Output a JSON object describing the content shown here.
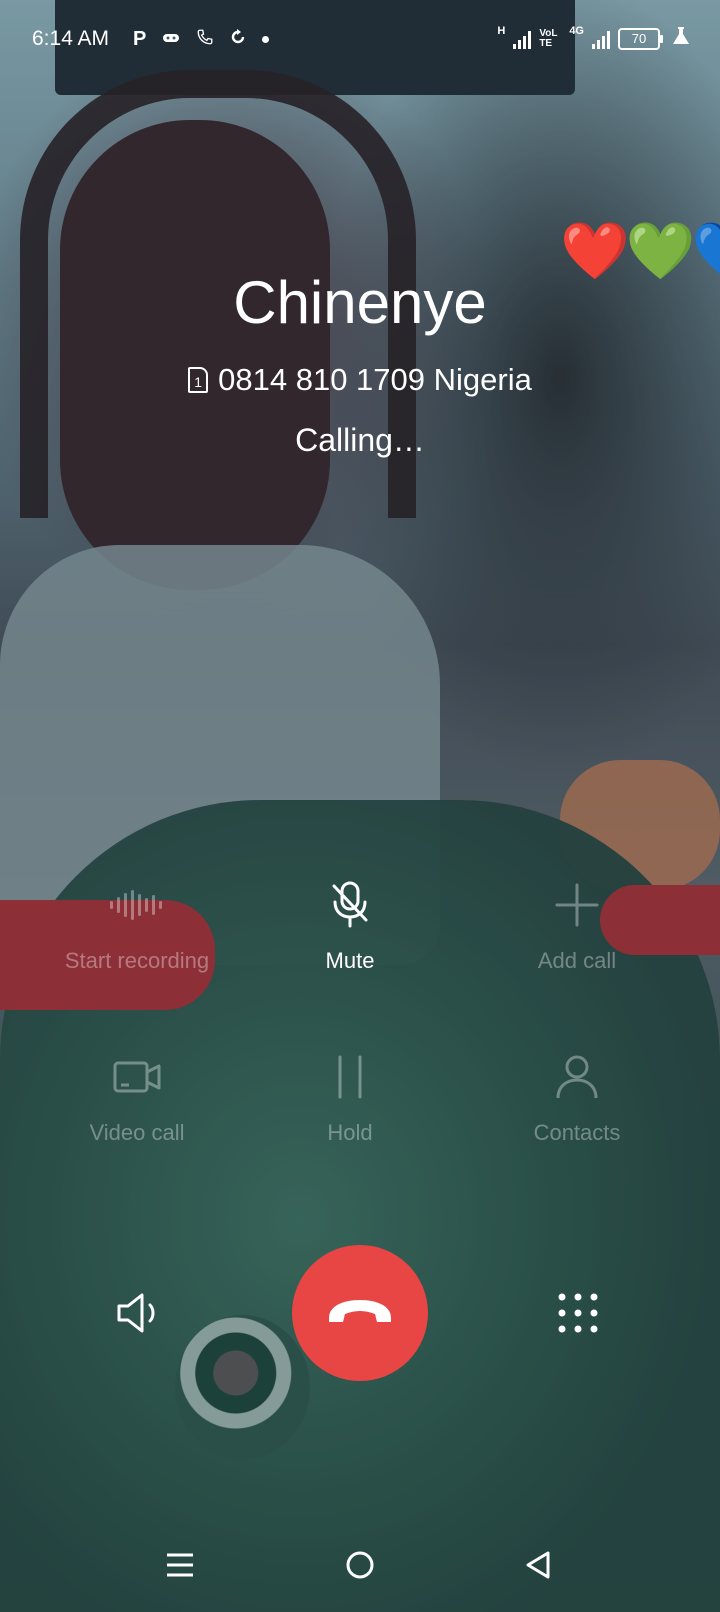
{
  "status_bar": {
    "time": "6:14 AM",
    "network_1": "H",
    "network_2": "VoLTE",
    "network_3": "4G",
    "battery": "70"
  },
  "wallpaper_emoji": "❤️💚💙",
  "caller": {
    "name": "Chinenye",
    "sim_slot": "1",
    "number": "0814 810 1709 Nigeria",
    "status": "Calling…"
  },
  "actions": {
    "start_recording": "Start recording",
    "mute": "Mute",
    "add_call": "Add call",
    "video_call": "Video call",
    "hold": "Hold",
    "contacts": "Contacts"
  },
  "colors": {
    "end_call": "#e84545",
    "text": "#ffffff"
  },
  "icons": {
    "speaker": "speaker-icon",
    "end_call": "end-call-icon",
    "dialpad": "dialpad-icon"
  }
}
